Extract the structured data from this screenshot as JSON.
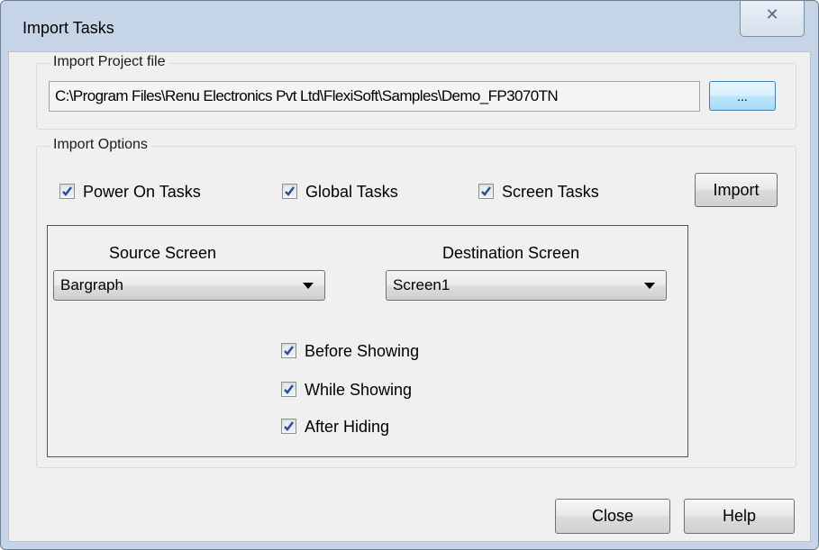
{
  "window": {
    "title": "Import Tasks",
    "close_glyph": "✕"
  },
  "project_group": {
    "label": "Import Project file",
    "path": "C:\\Program Files\\Renu Electronics Pvt Ltd\\FlexiSoft\\Samples\\Demo_FP3070TN",
    "browse_label": "..."
  },
  "options_group": {
    "label": "Import Options",
    "checkboxes": [
      {
        "label": "Power On Tasks",
        "checked": true
      },
      {
        "label": "Global Tasks",
        "checked": true
      },
      {
        "label": "Screen Tasks",
        "checked": true
      }
    ],
    "import_label": "Import"
  },
  "screens": {
    "source_label": "Source Screen",
    "source_value": "Bargraph",
    "destination_label": "Destination Screen",
    "destination_value": "Screen1",
    "event_checkboxes": [
      {
        "label": "Before Showing",
        "checked": true
      },
      {
        "label": "While Showing",
        "checked": true
      },
      {
        "label": "After Hiding",
        "checked": true
      }
    ]
  },
  "footer": {
    "close_label": "Close",
    "help_label": "Help"
  },
  "colors": {
    "titlebar": "#c5d5e7",
    "client": "#f0f0f0",
    "check": "#2a4c8c",
    "browse_accent": "#3c7fb1"
  }
}
